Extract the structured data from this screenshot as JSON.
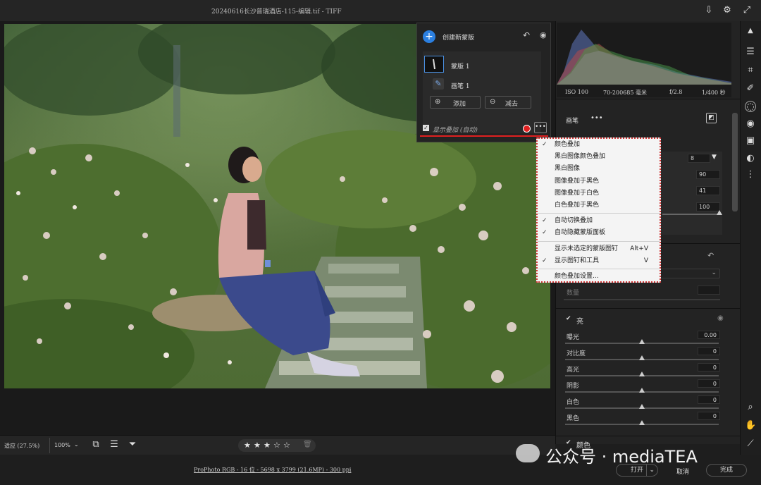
{
  "window": {
    "title": "20240616长沙普瑞酒店-115-编辑.tif -  TIFF"
  },
  "mask_panel": {
    "create_label": "创建新蒙版",
    "mask_item": "蒙版 1",
    "brush_item": "画笔 1",
    "add_label": "添加",
    "subtract_label": "减去",
    "overlay_label": "显示叠加 (自动)",
    "overlay_color": "#e02020"
  },
  "overlay_menu": {
    "items": [
      {
        "label": "颜色叠加",
        "checked": true,
        "shortcut": ""
      },
      {
        "label": "黑白图像颜色叠加",
        "checked": false,
        "shortcut": ""
      },
      {
        "label": "黑白图像",
        "checked": false,
        "shortcut": ""
      },
      {
        "label": "图像叠加于黑色",
        "checked": false,
        "shortcut": ""
      },
      {
        "label": "图像叠加于白色",
        "checked": false,
        "shortcut": ""
      },
      {
        "label": "白色叠加于黑色",
        "checked": false,
        "shortcut": ""
      },
      {
        "label": "自动切换叠加",
        "checked": true,
        "shortcut": ""
      },
      {
        "label": "自动隐藏蒙版面板",
        "checked": true,
        "shortcut": ""
      },
      {
        "label": "显示未选定的蒙版图钉",
        "checked": false,
        "shortcut": "Alt+V"
      },
      {
        "label": "显示图钉和工具",
        "checked": true,
        "shortcut": "V"
      },
      {
        "label": "颜色叠加设置...",
        "checked": false,
        "shortcut": ""
      }
    ]
  },
  "histogram": {
    "iso": "ISO 100",
    "lens": "70-200685 毫米",
    "aperture": "f/2.8",
    "shutter": "1/400 秒"
  },
  "brush_panel": {
    "title": "画笔",
    "size_value": "8",
    "feather_value": "90",
    "flow_value": "41",
    "density_value": "100",
    "amount_label": "数量"
  },
  "light_section": {
    "title": "亮",
    "sliders": [
      {
        "label": "曝光",
        "value": "0.00",
        "position": 0.5
      },
      {
        "label": "对比度",
        "value": "0",
        "position": 0.5
      },
      {
        "label": "高光",
        "value": "0",
        "position": 0.5
      },
      {
        "label": "阴影",
        "value": "0",
        "position": 0.5
      },
      {
        "label": "白色",
        "value": "0",
        "position": 0.5
      },
      {
        "label": "黑色",
        "value": "0",
        "position": 0.5
      }
    ]
  },
  "color_section": {
    "title": "颜色"
  },
  "bottom_bar": {
    "fit_label": "适应 (27.5%)",
    "zoom_label": "100%",
    "rating": 3,
    "max_rating": 5
  },
  "status": {
    "file_info": "ProPhoto RGB - 16 位 - 5698 x 3799 (21.6MP) - 300 ppi",
    "open_label": "打开",
    "cancel_label": "取消",
    "done_label": "完成"
  },
  "watermark": {
    "text": "公众号 · mediaTEA"
  }
}
